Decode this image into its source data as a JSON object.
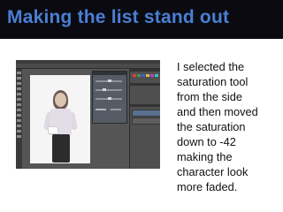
{
  "slide": {
    "title": "Making the list stand out",
    "body_lines": [
      "I selected the",
      "saturation tool",
      "from the side",
      "and  then moved",
      "the saturation",
      "down to -42",
      "making the",
      "character look",
      "more faded."
    ]
  },
  "colors": {
    "title_bar_bg": "#0a0a10",
    "title_text": "#4a7fd4",
    "body_text": "#111111",
    "app_bg": "#555555"
  },
  "screenshot": {
    "app": "photo-editor",
    "adjustment_value": "-42"
  }
}
